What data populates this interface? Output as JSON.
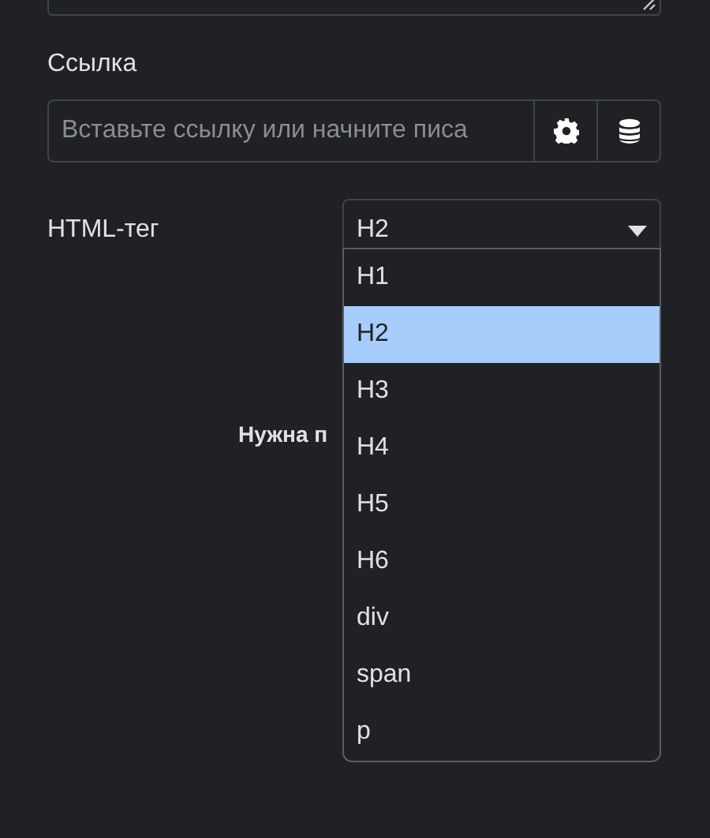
{
  "link": {
    "label": "Ссылка",
    "placeholder": "Вставьте ссылку или начните писа"
  },
  "html_tag": {
    "label": "HTML-тег",
    "value": "H2",
    "expanded": true,
    "options": [
      {
        "label": "H1",
        "selected": false
      },
      {
        "label": "H2",
        "selected": true
      },
      {
        "label": "H3",
        "selected": false
      },
      {
        "label": "H4",
        "selected": false
      },
      {
        "label": "H5",
        "selected": false
      },
      {
        "label": "H6",
        "selected": false
      },
      {
        "label": "div",
        "selected": false
      },
      {
        "label": "span",
        "selected": false
      },
      {
        "label": "p",
        "selected": false
      }
    ]
  },
  "note": "Нужна п"
}
